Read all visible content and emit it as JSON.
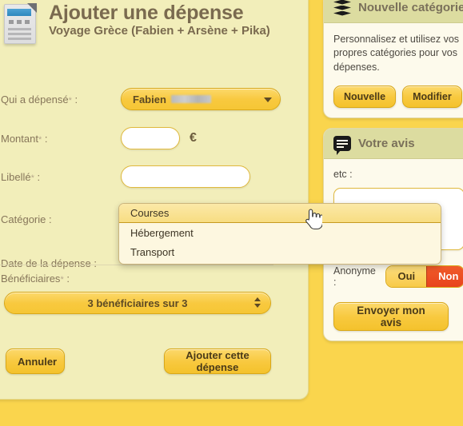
{
  "left_panel": {
    "icon": "document-icon",
    "title": "Ajouter une dépense",
    "subtitle": "Voyage Grèce (Fabien + Arsène + Pika)",
    "fields": {
      "qui_label": "Qui a dépensé",
      "qui_required": "*",
      "qui_colon": ":",
      "qui_value": "Fabien",
      "montant_label": "Montant",
      "montant_required": "*",
      "montant_colon": ":",
      "montant_value": "",
      "montant_placeholder": "",
      "montant_unit": "€",
      "libelle_label": "Libellé",
      "libelle_required": "*",
      "libelle_colon": ":",
      "libelle_value": "",
      "libelle_placeholder": "",
      "categorie_label": "Catégorie :",
      "date_label": "Date de la dépense :",
      "benef_label": "Bénéficiaires",
      "benef_required": "*",
      "benef_colon": ":",
      "benef_value": "3 bénéficiaires sur 3"
    },
    "buttons": {
      "cancel": "Annuler",
      "submit": "Ajouter cette dépense"
    }
  },
  "dropdown": {
    "open": true,
    "selected": "Courses",
    "options": [
      "Courses",
      "Hébergement",
      "Transport"
    ]
  },
  "cursor": "hand-pointer-cursor",
  "right_column": {
    "category_card": {
      "icon": "layers-icon",
      "title": "Nouvelle catégorie",
      "text": "Personnalisez et utilisez vos propres catégories pour vos dépenses.",
      "btn_new": "Nouvelle",
      "btn_edit": "Modifier"
    },
    "feedback_card": {
      "icon": "speech-bubble-icon",
      "title": "Votre avis",
      "line1": "etc :",
      "textarea_value": "",
      "anon_label": "Anonyme :",
      "toggle_yes": "Oui",
      "toggle_no": "Non",
      "toggle_selected": "Non",
      "submit": "Envoyer mon avis"
    }
  },
  "colors": {
    "page_background": "#fad54d",
    "panel_background": "#f2eeba",
    "card_background": "#fdfaec",
    "card_header": "#dcdca0",
    "gold": "#f8c93f",
    "gold_border": "#d9a818",
    "accent_red": "#e8441c",
    "title_text": "#7a6a4f",
    "label_text": "#87765a"
  }
}
